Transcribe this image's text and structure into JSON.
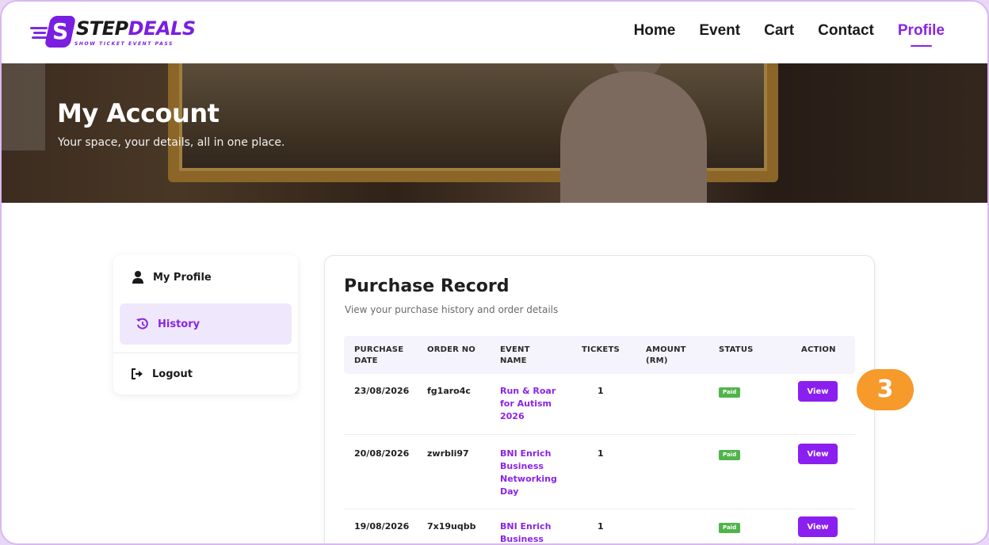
{
  "brand": {
    "name_part1": "STEP",
    "name_part2": "DEALS",
    "tagline": "SHOW TICKET EVENT PASS",
    "badge_letter": "S"
  },
  "nav": {
    "items": [
      "Home",
      "Event",
      "Cart",
      "Contact",
      "Profile"
    ],
    "active": "Profile"
  },
  "hero": {
    "title": "My Account",
    "subtitle": "Your space, your details, all in one place."
  },
  "sidebar": {
    "items": [
      {
        "label": "My Profile",
        "icon": "user-icon"
      },
      {
        "label": "History",
        "icon": "history-icon"
      },
      {
        "label": "Logout",
        "icon": "logout-icon"
      }
    ],
    "active": "History"
  },
  "purchase": {
    "title": "Purchase Record",
    "subtitle": "View your purchase history and order details",
    "columns": {
      "purchase_date": "PURCHASE DATE",
      "order_no": "ORDER NO",
      "event_name": "EVENT NAME",
      "tickets": "TICKETS",
      "amount": "AMOUNT (RM)",
      "status": "STATUS",
      "action": "ACTION"
    },
    "rows": [
      {
        "date": "23/08/2026",
        "order": "fg1aro4c",
        "event": "Run & Roar for Autism 2026",
        "tickets": "1",
        "amount": "",
        "status": "Paid",
        "action": "View"
      },
      {
        "date": "20/08/2026",
        "order": "zwrbli97",
        "event": "BNI Enrich Business Networking Day",
        "tickets": "1",
        "amount": "",
        "status": "Paid",
        "action": "View"
      },
      {
        "date": "19/08/2026",
        "order": "7x19uqbb",
        "event": "BNI Enrich Business",
        "tickets": "1",
        "amount": "",
        "status": "Paid",
        "action": "View"
      }
    ]
  },
  "step_marker": "3",
  "colors": {
    "accent": "#8a24e6",
    "button": "#8a1ff0",
    "paid": "#4fb54b",
    "marker": "#f59a2b"
  }
}
